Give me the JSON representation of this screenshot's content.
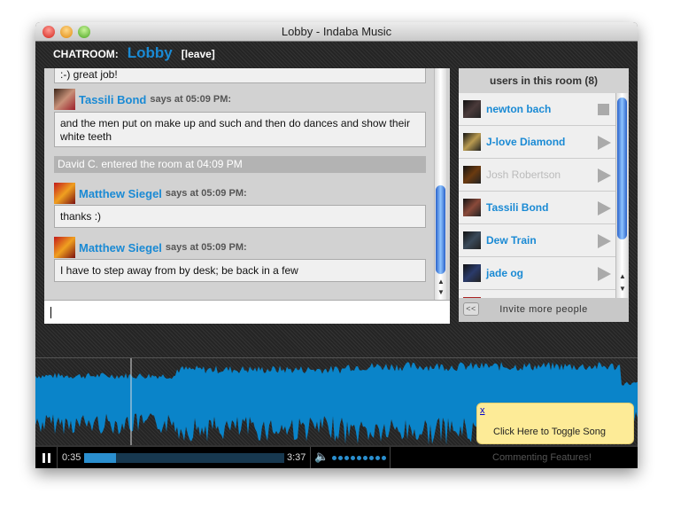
{
  "window": {
    "title": "Lobby - Indaba Music"
  },
  "header": {
    "label": "CHATROOM:",
    "room": "Lobby",
    "leave": "[leave]"
  },
  "chat": {
    "partial_message": ":-) great job!",
    "messages": [
      {
        "user": "Tassili Bond",
        "says": "says at 05:09 PM:",
        "text": "and the men put on make up and such and then do dances and show their white teeth"
      },
      {
        "user": "Matthew Siegel",
        "says": "says at 05:09 PM:",
        "text": "thanks :)"
      },
      {
        "user": "Matthew Siegel",
        "says": "says at 05:09 PM:",
        "text": "I have to step away from by desk; be back in a few"
      }
    ],
    "system": "David C. entered the room at 04:09 PM",
    "input_value": ""
  },
  "users": {
    "title": "users in this room (8)",
    "list": [
      {
        "name": "newton bach",
        "online": true,
        "state": "stop"
      },
      {
        "name": "J-love Diamond",
        "online": true,
        "state": "play"
      },
      {
        "name": "Josh Robertson",
        "online": false,
        "state": "play"
      },
      {
        "name": "Tassili Bond",
        "online": true,
        "state": "play"
      },
      {
        "name": "Dew Train",
        "online": true,
        "state": "play"
      },
      {
        "name": "jade og",
        "online": true,
        "state": "play"
      }
    ],
    "invite": "Invite more people",
    "collapse": "<<"
  },
  "player": {
    "elapsed": "0:35",
    "duration": "3:37",
    "progress_percent": 16,
    "volume_dots": 9,
    "playing": true,
    "waveform_color": "#0a84c9"
  },
  "tooltip": {
    "close": "x",
    "text": "Click Here to Toggle Song",
    "behind_text": "Commenting Features!"
  }
}
